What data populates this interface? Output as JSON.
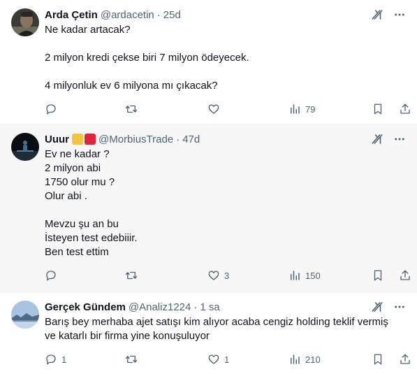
{
  "tweets": [
    {
      "name": "Arda Çetin",
      "handle": "@ardacetin",
      "separator": "·",
      "time": "25d",
      "text": "Ne kadar artacak?\n\n2 milyon kredi çekse biri 7 milyon ödeyecek.\n\n4 milyonluk ev 6 milyona mı çıkacak?",
      "replies": "",
      "retweets": "",
      "likes": "",
      "views": "79",
      "avatar_icon": "man-portrait-icon"
    },
    {
      "name": "Uuur",
      "handle": "@MorbiusTrade",
      "separator": "·",
      "time": "47d",
      "text": "Ev ne kadar ?\n2 milyon abi\n1750 olur mu ?\nOlur abi .\n\nMevzu şu an bu\nİsteyen test edebiiir.\nBen test ettim",
      "replies": "",
      "retweets": "",
      "likes": "3",
      "views": "150",
      "badge_colors": [
        "#f4c542",
        "#e0243a"
      ],
      "avatar_icon": "person-on-beach-icon"
    },
    {
      "name": "Gerçek Gündem",
      "handle": "@Analiz1224",
      "separator": "·",
      "time": "1 sa",
      "text": "Barış bey merhaba ajet satışı kim alıyor acaba cengiz holding teklif vermiş ve katarlı bir firma yine konuşuluyor",
      "replies": "1",
      "retweets": "",
      "likes": "1",
      "views": "210",
      "avatar_icon": "landscape-icon"
    }
  ],
  "colors": {
    "text": "#0f1419",
    "secondary": "#536471",
    "highlight_bg": "#f7f7f7",
    "border": "#eff3f4"
  }
}
